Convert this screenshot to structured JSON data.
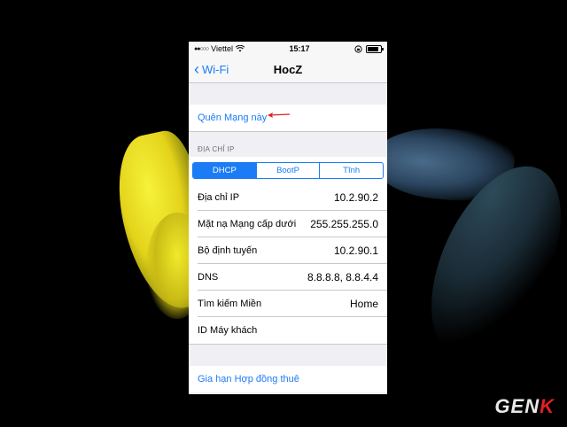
{
  "status_bar": {
    "carrier": "Viettel",
    "time": "15:17"
  },
  "nav": {
    "back_label": "Wi-Fi",
    "title": "HocZ"
  },
  "forget_network": "Quên Mạng này",
  "ip_section": {
    "header": "ĐỊA CHỈ IP",
    "tabs": [
      "DHCP",
      "BootP",
      "Tĩnh"
    ],
    "selected_tab": "DHCP"
  },
  "rows": [
    {
      "label": "Địa chỉ IP",
      "value": "10.2.90.2"
    },
    {
      "label": "Mặt nạ Mạng cấp dưới",
      "value": "255.255.255.0"
    },
    {
      "label": "Bộ định tuyến",
      "value": "10.2.90.1"
    },
    {
      "label": "DNS",
      "value": "8.8.8.8, 8.8.4.4"
    },
    {
      "label": "Tìm kiếm Miền",
      "value": "Home"
    },
    {
      "label": "ID Máy khách",
      "value": ""
    }
  ],
  "renew_lease": "Gia hạn Hợp đồng thuê",
  "watermark": {
    "part1": "GEN",
    "part2": "K"
  },
  "colors": {
    "accent": "#1b7cf5",
    "arrow": "#e02020"
  }
}
